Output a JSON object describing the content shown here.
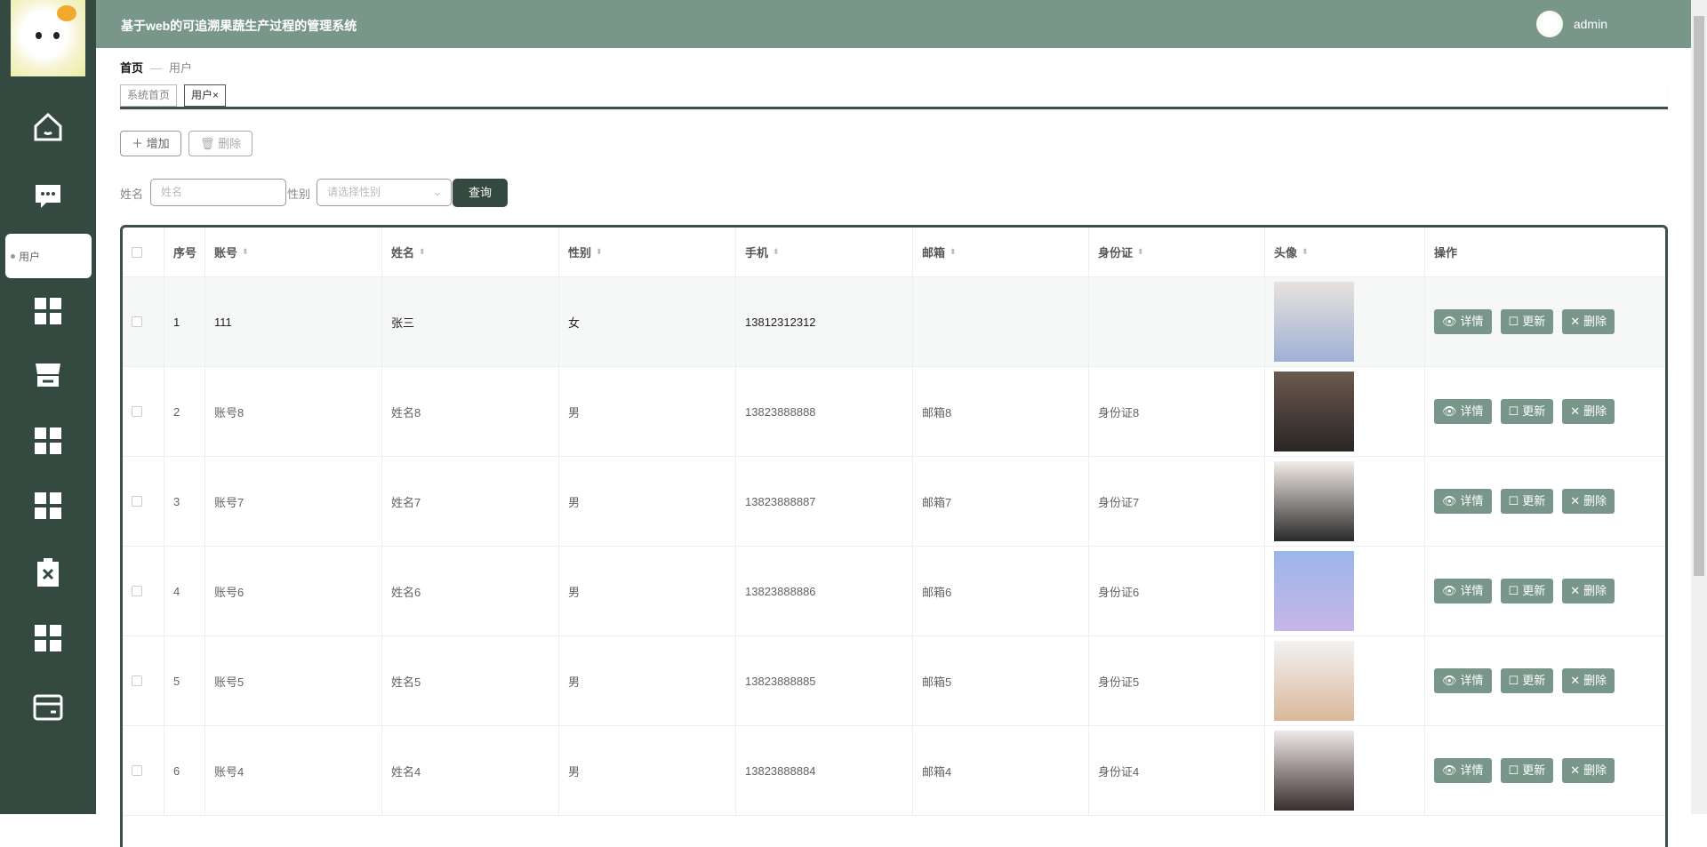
{
  "header": {
    "title": "基于web的可追溯果蔬生产过程的管理系统",
    "username": "admin"
  },
  "sidebar": {
    "submenu_label": "用户"
  },
  "breadcrumb": {
    "home": "首页",
    "separator": "—",
    "current": "用户"
  },
  "tabs": [
    {
      "label": "系统首页"
    },
    {
      "label": "用户",
      "close": "×"
    }
  ],
  "toolbar": {
    "add": "增加",
    "delete": "删除"
  },
  "search": {
    "name_label": "姓名",
    "name_placeholder": "姓名",
    "gender_label": "性别",
    "gender_placeholder": "请选择性别",
    "query": "查询"
  },
  "table": {
    "columns": [
      "序号",
      "账号",
      "姓名",
      "性别",
      "手机",
      "邮箱",
      "身份证",
      "头像",
      "操作"
    ],
    "actions": {
      "detail": "详情",
      "update": "更新",
      "delete": "删除"
    },
    "rows": [
      {
        "no": "1",
        "account": "111",
        "name": "张三",
        "gender": "女",
        "phone": "13812312312",
        "email": "",
        "id_card": ""
      },
      {
        "no": "2",
        "account": "账号8",
        "name": "姓名8",
        "gender": "男",
        "phone": "13823888888",
        "email": "邮箱8",
        "id_card": "身份证8"
      },
      {
        "no": "3",
        "account": "账号7",
        "name": "姓名7",
        "gender": "男",
        "phone": "13823888887",
        "email": "邮箱7",
        "id_card": "身份证7"
      },
      {
        "no": "4",
        "account": "账号6",
        "name": "姓名6",
        "gender": "男",
        "phone": "13823888886",
        "email": "邮箱6",
        "id_card": "身份证6"
      },
      {
        "no": "5",
        "account": "账号5",
        "name": "姓名5",
        "gender": "男",
        "phone": "13823888885",
        "email": "邮箱5",
        "id_card": "身份证5"
      },
      {
        "no": "6",
        "account": "账号4",
        "name": "姓名4",
        "gender": "男",
        "phone": "13823888884",
        "email": "邮箱4",
        "id_card": "身份证4"
      }
    ]
  },
  "colors": {
    "sidebar": "#34493f",
    "header": "#78978a",
    "accent": "#78978a"
  }
}
